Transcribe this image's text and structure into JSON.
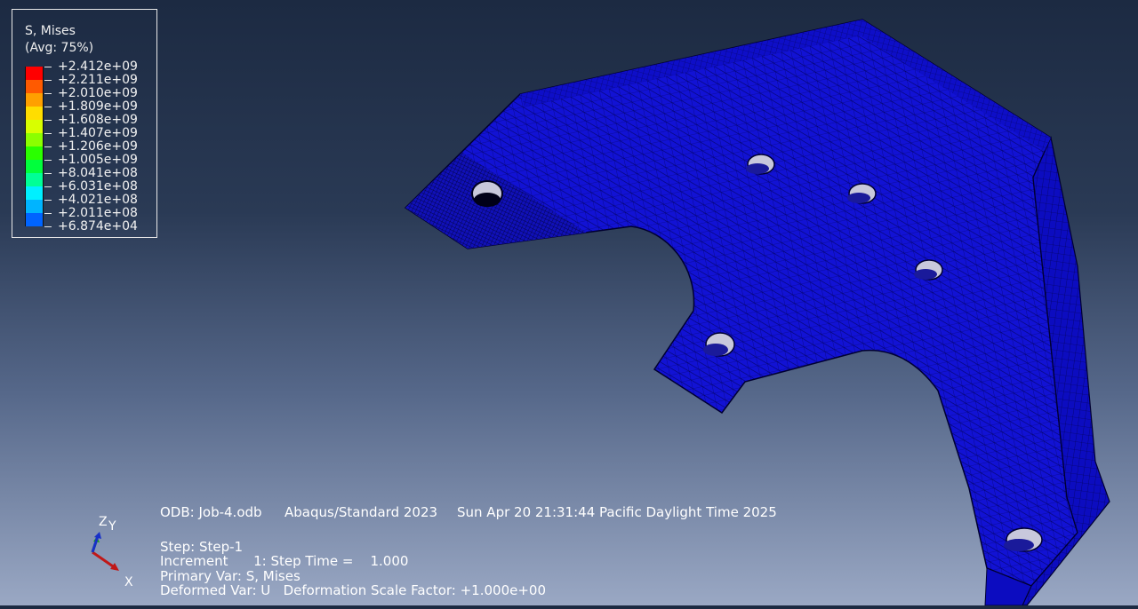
{
  "legend": {
    "variable": "S, Mises",
    "averaging": "(Avg: 75%)",
    "values": [
      "+2.412e+09",
      "+2.211e+09",
      "+2.010e+09",
      "+1.809e+09",
      "+1.608e+09",
      "+1.407e+09",
      "+1.206e+09",
      "+1.005e+09",
      "+8.041e+08",
      "+6.031e+08",
      "+4.021e+08",
      "+2.011e+08",
      "+6.874e+04"
    ],
    "colors": [
      "#ff0000",
      "#ff5a00",
      "#ffa000",
      "#ffdd00",
      "#d8ff00",
      "#8cff00",
      "#2aff00",
      "#00ff3c",
      "#00ff96",
      "#00f0ff",
      "#00b4ff",
      "#0064ff",
      "#0018ff"
    ]
  },
  "info": {
    "odb": "ODB: Job-4.odb",
    "solver": "Abaqus/Standard 2023",
    "date": "Sun Apr 20 21:31:44 Pacific Daylight Time 2025",
    "step": "Step: Step-1",
    "increment": "Increment      1: Step Time =    1.000",
    "primary_var": "Primary Var: S, Mises",
    "deformed_var": "Deformed Var: U   Deformation Scale Factor: +1.000e+00"
  },
  "triad": {
    "x_label": "X",
    "y_label": "Y",
    "z_label": "Z"
  },
  "colors": {
    "part_fill": "#1010d6",
    "mesh_line": "#000040",
    "background_top": "#1c2a42",
    "background_bottom": "#9aa8c4"
  }
}
